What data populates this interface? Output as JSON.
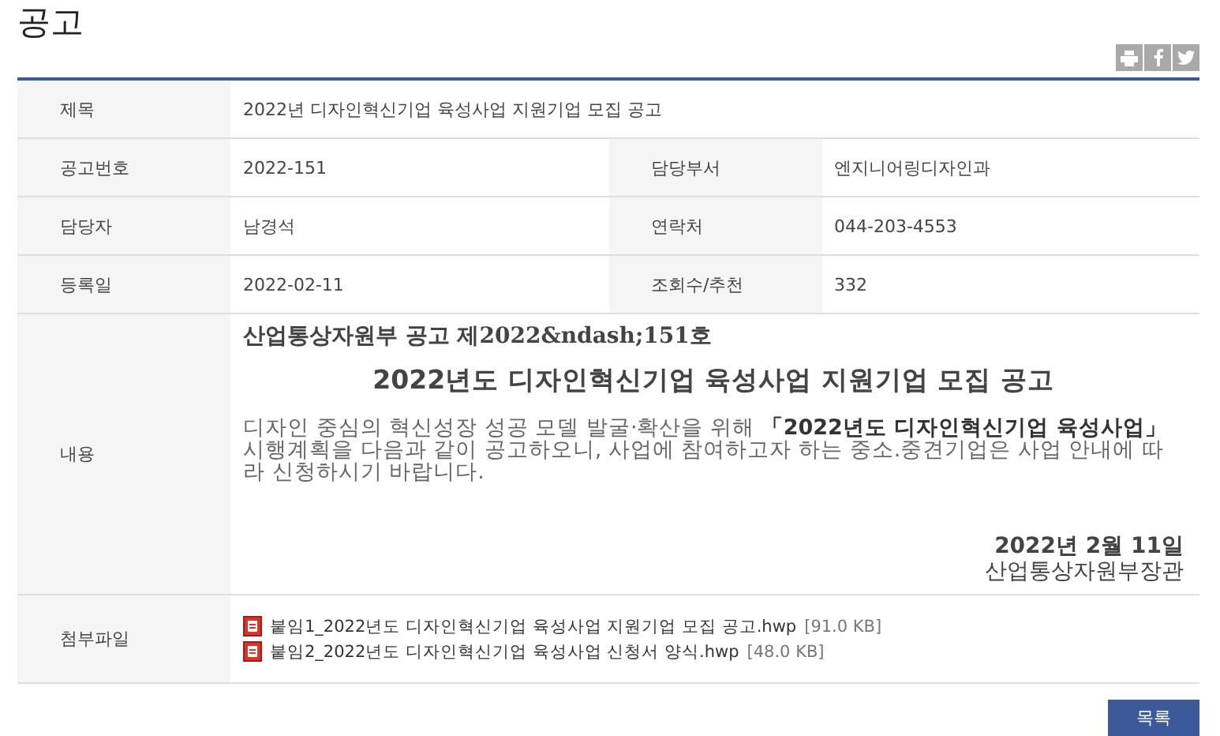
{
  "page_title": "공고",
  "share": [
    {
      "kind": "print"
    },
    {
      "kind": "facebook"
    },
    {
      "kind": "twitter"
    }
  ],
  "rows": [
    {
      "fields": [
        {
          "label": "제목",
          "value": "2022년 디자인혁신기업 육성사업 지원기업 모집 공고"
        }
      ]
    },
    {
      "fields": [
        {
          "label": "공고번호",
          "value": "2022-151"
        },
        {
          "label": "담당부서",
          "value": "엔지니어링디자인과"
        }
      ]
    },
    {
      "fields": [
        {
          "label": "담당자",
          "value": "남경석"
        },
        {
          "label": "연락처",
          "value": "044-203-4553"
        }
      ]
    },
    {
      "fields": [
        {
          "label": "등록일",
          "value": "2022-02-11"
        },
        {
          "label": "조회수/추천",
          "value": "332"
        }
      ]
    }
  ],
  "content": {
    "label": "내용",
    "header": "산업통상자원부  공고  제2022&ndash;151호",
    "heading": "2022년도 디자인혁신기업 육성사업 지원기업 모집 공고",
    "body": "디자인 중심의 혁신성장 성공 모델 발굴·확산을 위해 **「2022년도 디자인혁신기업 육성사업」**시행계획을 다음과 같이 공고하오니, 사업에 참여하고자 하는 중소.중견기업은 사업 안내에 따라 신청하시기 바랍니다.",
    "date": "2022년 2월 11일",
    "issuer": "산업통상자원부장관"
  },
  "attachments": {
    "label": "첨부파일",
    "files": [
      {
        "name": "붙임1_2022년도 디자인혁신기업 육성사업 지원기업 모집 공고.hwp",
        "size": "[91.0 KB]"
      },
      {
        "name": "붙임2_2022년도 디자인혁신기업 육성사업 신청서 양식.hwp",
        "size": "[48.0 KB]"
      }
    ]
  },
  "list_button": "목록"
}
